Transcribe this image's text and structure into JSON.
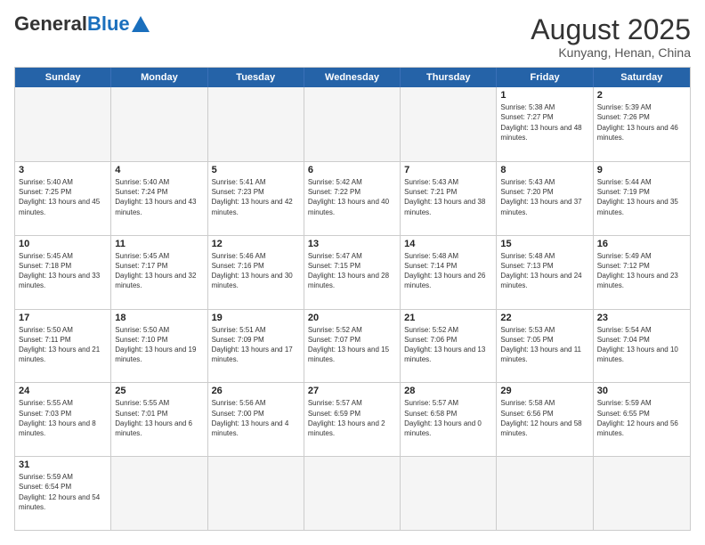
{
  "logo": {
    "general": "General",
    "blue": "Blue",
    "tagline": "Blue"
  },
  "title": {
    "month_year": "August 2025",
    "location": "Kunyang, Henan, China"
  },
  "header_days": [
    "Sunday",
    "Monday",
    "Tuesday",
    "Wednesday",
    "Thursday",
    "Friday",
    "Saturday"
  ],
  "weeks": [
    [
      {
        "day": "",
        "empty": true
      },
      {
        "day": "",
        "empty": true
      },
      {
        "day": "",
        "empty": true
      },
      {
        "day": "",
        "empty": true
      },
      {
        "day": "",
        "empty": true
      },
      {
        "day": "1",
        "sunrise": "5:38 AM",
        "sunset": "7:27 PM",
        "daylight": "13 hours and 48 minutes."
      },
      {
        "day": "2",
        "sunrise": "5:39 AM",
        "sunset": "7:26 PM",
        "daylight": "13 hours and 46 minutes."
      }
    ],
    [
      {
        "day": "3",
        "sunrise": "5:40 AM",
        "sunset": "7:25 PM",
        "daylight": "13 hours and 45 minutes."
      },
      {
        "day": "4",
        "sunrise": "5:40 AM",
        "sunset": "7:24 PM",
        "daylight": "13 hours and 43 minutes."
      },
      {
        "day": "5",
        "sunrise": "5:41 AM",
        "sunset": "7:23 PM",
        "daylight": "13 hours and 42 minutes."
      },
      {
        "day": "6",
        "sunrise": "5:42 AM",
        "sunset": "7:22 PM",
        "daylight": "13 hours and 40 minutes."
      },
      {
        "day": "7",
        "sunrise": "5:43 AM",
        "sunset": "7:21 PM",
        "daylight": "13 hours and 38 minutes."
      },
      {
        "day": "8",
        "sunrise": "5:43 AM",
        "sunset": "7:20 PM",
        "daylight": "13 hours and 37 minutes."
      },
      {
        "day": "9",
        "sunrise": "5:44 AM",
        "sunset": "7:19 PM",
        "daylight": "13 hours and 35 minutes."
      }
    ],
    [
      {
        "day": "10",
        "sunrise": "5:45 AM",
        "sunset": "7:18 PM",
        "daylight": "13 hours and 33 minutes."
      },
      {
        "day": "11",
        "sunrise": "5:45 AM",
        "sunset": "7:17 PM",
        "daylight": "13 hours and 32 minutes."
      },
      {
        "day": "12",
        "sunrise": "5:46 AM",
        "sunset": "7:16 PM",
        "daylight": "13 hours and 30 minutes."
      },
      {
        "day": "13",
        "sunrise": "5:47 AM",
        "sunset": "7:15 PM",
        "daylight": "13 hours and 28 minutes."
      },
      {
        "day": "14",
        "sunrise": "5:48 AM",
        "sunset": "7:14 PM",
        "daylight": "13 hours and 26 minutes."
      },
      {
        "day": "15",
        "sunrise": "5:48 AM",
        "sunset": "7:13 PM",
        "daylight": "13 hours and 24 minutes."
      },
      {
        "day": "16",
        "sunrise": "5:49 AM",
        "sunset": "7:12 PM",
        "daylight": "13 hours and 23 minutes."
      }
    ],
    [
      {
        "day": "17",
        "sunrise": "5:50 AM",
        "sunset": "7:11 PM",
        "daylight": "13 hours and 21 minutes."
      },
      {
        "day": "18",
        "sunrise": "5:50 AM",
        "sunset": "7:10 PM",
        "daylight": "13 hours and 19 minutes."
      },
      {
        "day": "19",
        "sunrise": "5:51 AM",
        "sunset": "7:09 PM",
        "daylight": "13 hours and 17 minutes."
      },
      {
        "day": "20",
        "sunrise": "5:52 AM",
        "sunset": "7:07 PM",
        "daylight": "13 hours and 15 minutes."
      },
      {
        "day": "21",
        "sunrise": "5:52 AM",
        "sunset": "7:06 PM",
        "daylight": "13 hours and 13 minutes."
      },
      {
        "day": "22",
        "sunrise": "5:53 AM",
        "sunset": "7:05 PM",
        "daylight": "13 hours and 11 minutes."
      },
      {
        "day": "23",
        "sunrise": "5:54 AM",
        "sunset": "7:04 PM",
        "daylight": "13 hours and 10 minutes."
      }
    ],
    [
      {
        "day": "24",
        "sunrise": "5:55 AM",
        "sunset": "7:03 PM",
        "daylight": "13 hours and 8 minutes."
      },
      {
        "day": "25",
        "sunrise": "5:55 AM",
        "sunset": "7:01 PM",
        "daylight": "13 hours and 6 minutes."
      },
      {
        "day": "26",
        "sunrise": "5:56 AM",
        "sunset": "7:00 PM",
        "daylight": "13 hours and 4 minutes."
      },
      {
        "day": "27",
        "sunrise": "5:57 AM",
        "sunset": "6:59 PM",
        "daylight": "13 hours and 2 minutes."
      },
      {
        "day": "28",
        "sunrise": "5:57 AM",
        "sunset": "6:58 PM",
        "daylight": "13 hours and 0 minutes."
      },
      {
        "day": "29",
        "sunrise": "5:58 AM",
        "sunset": "6:56 PM",
        "daylight": "12 hours and 58 minutes."
      },
      {
        "day": "30",
        "sunrise": "5:59 AM",
        "sunset": "6:55 PM",
        "daylight": "12 hours and 56 minutes."
      }
    ],
    [
      {
        "day": "31",
        "sunrise": "5:59 AM",
        "sunset": "6:54 PM",
        "daylight": "12 hours and 54 minutes."
      },
      {
        "day": "",
        "empty": true
      },
      {
        "day": "",
        "empty": true
      },
      {
        "day": "",
        "empty": true
      },
      {
        "day": "",
        "empty": true
      },
      {
        "day": "",
        "empty": true
      },
      {
        "day": "",
        "empty": true
      }
    ]
  ]
}
